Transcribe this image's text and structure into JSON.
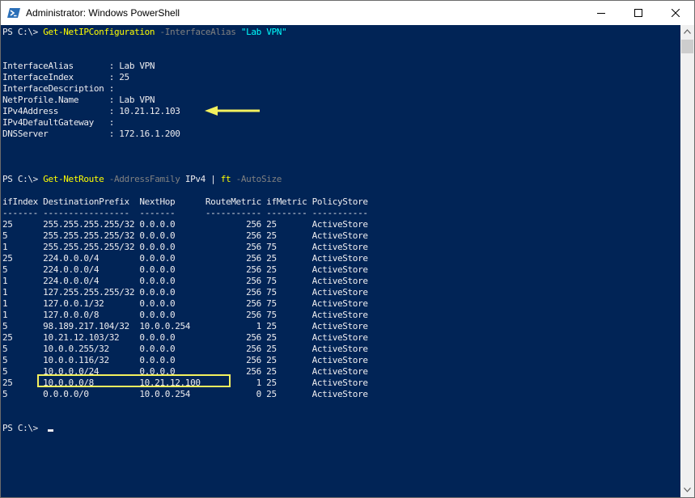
{
  "window": {
    "title": "Administrator: Windows PowerShell",
    "icon": "powershell-icon",
    "controls": [
      "minimize-icon",
      "maximize-icon",
      "close-icon"
    ]
  },
  "colors": {
    "console_bg": "#012456",
    "text": "#eeedf0",
    "command": "#ffff00",
    "parameter": "#808080",
    "string": "#00ffff",
    "annotation": "#f3f15e"
  },
  "command1": {
    "prompt": "PS C:\\> ",
    "cmdlet": "Get-NetIPConfiguration",
    "param": " -InterfaceAlias ",
    "arg": "\"Lab VPN\""
  },
  "ipconfig": [
    {
      "key": "InterfaceAlias       ",
      "sep": ": ",
      "value": "Lab VPN"
    },
    {
      "key": "InterfaceIndex       ",
      "sep": ": ",
      "value": "25"
    },
    {
      "key": "InterfaceDescription ",
      "sep": ": ",
      "value": ""
    },
    {
      "key": "NetProfile.Name      ",
      "sep": ": ",
      "value": "Lab VPN"
    },
    {
      "key": "IPv4Address          ",
      "sep": ": ",
      "value": "10.21.12.103"
    },
    {
      "key": "IPv4DefaultGateway   ",
      "sep": ": ",
      "value": ""
    },
    {
      "key": "DNSServer            ",
      "sep": ": ",
      "value": "172.16.1.200"
    }
  ],
  "command2": {
    "prompt": "PS C:\\> ",
    "cmdlet": "Get-NetRoute",
    "param": " -AddressFamily ",
    "arg": "IPv4",
    "pipe": " | ",
    "cmdlet2": "ft",
    "param2": " -AutoSize"
  },
  "route_table": {
    "header": "ifIndex DestinationPrefix  NextHop      RouteMetric ifMetric PolicyStore",
    "separator": "------- -----------------  -------      ----------- -------- -----------",
    "rows": [
      "25      255.255.255.255/32 0.0.0.0              256 25       ActiveStore",
      "5       255.255.255.255/32 0.0.0.0              256 25       ActiveStore",
      "1       255.255.255.255/32 0.0.0.0              256 75       ActiveStore",
      "25      224.0.0.0/4        0.0.0.0              256 25       ActiveStore",
      "5       224.0.0.0/4        0.0.0.0              256 25       ActiveStore",
      "1       224.0.0.0/4        0.0.0.0              256 75       ActiveStore",
      "1       127.255.255.255/32 0.0.0.0              256 75       ActiveStore",
      "1       127.0.0.1/32       0.0.0.0              256 75       ActiveStore",
      "1       127.0.0.0/8        0.0.0.0              256 75       ActiveStore",
      "5       98.189.217.104/32  10.0.0.254             1 25       ActiveStore",
      "25      10.21.12.103/32    0.0.0.0              256 25       ActiveStore",
      "5       10.0.0.255/32      0.0.0.0              256 25       ActiveStore",
      "5       10.0.0.116/32      0.0.0.0              256 25       ActiveStore",
      "5       10.0.0.0/24        0.0.0.0              256 25       ActiveStore",
      "25      10.0.0.0/8         10.21.12.100           1 25       ActiveStore",
      "5       0.0.0.0/0          10.0.0.254             0 25       ActiveStore"
    ]
  },
  "final_prompt": "PS C:\\> "
}
